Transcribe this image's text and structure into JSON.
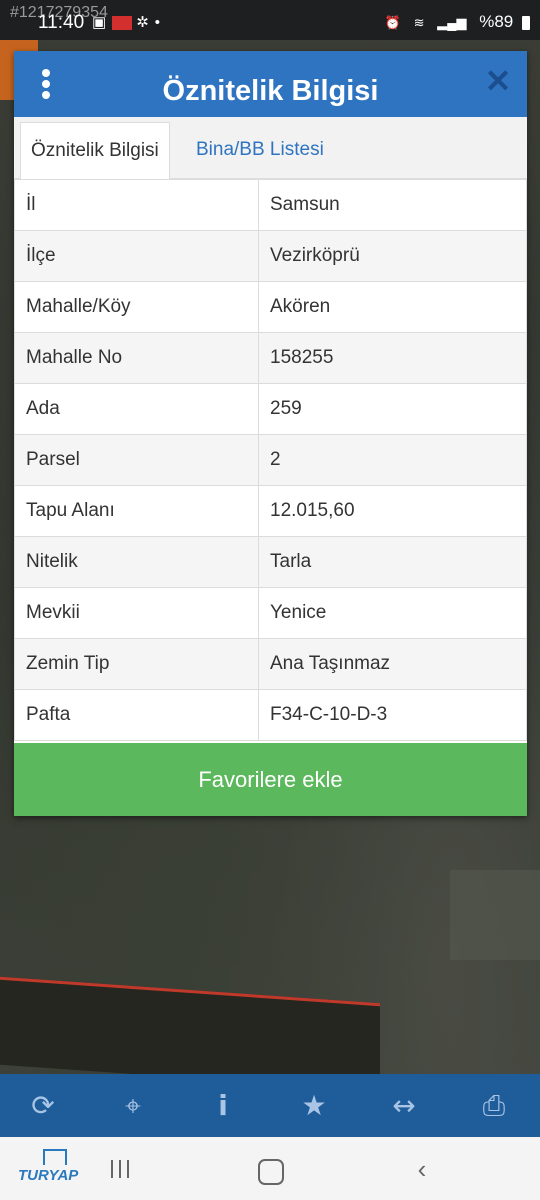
{
  "status_bar": {
    "watermark": "#1217279354",
    "time": "11:40",
    "battery_percent": "%89"
  },
  "dialog": {
    "title": "Öznitelik Bilgisi",
    "tabs": [
      "Öznitelik Bilgisi",
      "Bina/BB Listesi"
    ],
    "active_tab": 0,
    "rows": [
      {
        "key": "İl",
        "value": "Samsun"
      },
      {
        "key": "İlçe",
        "value": "Vezirköprü"
      },
      {
        "key": "Mahalle/Köy",
        "value": "Akören"
      },
      {
        "key": "Mahalle No",
        "value": "158255"
      },
      {
        "key": "Ada",
        "value": "259"
      },
      {
        "key": "Parsel",
        "value": "2"
      },
      {
        "key": "Tapu Alanı",
        "value": "12.015,60"
      },
      {
        "key": "Nitelik",
        "value": "Tarla"
      },
      {
        "key": "Mevkii",
        "value": "Yenice"
      },
      {
        "key": "Zemin Tip",
        "value": "Ana Taşınmaz"
      },
      {
        "key": "Pafta",
        "value": "F34-C-10-D-3"
      }
    ],
    "favorite_button": "Favorilere ekle"
  },
  "toolbar": {
    "icons": [
      "refresh-icon",
      "locate-icon",
      "info-icon",
      "star-icon",
      "measure-icon",
      "print-icon"
    ]
  },
  "nav_bar": {
    "logo_text": "TURYAP"
  },
  "colors": {
    "header_blue": "#2f74c0",
    "button_green": "#5cb85c",
    "toolbar_blue": "#1f5d9a"
  }
}
